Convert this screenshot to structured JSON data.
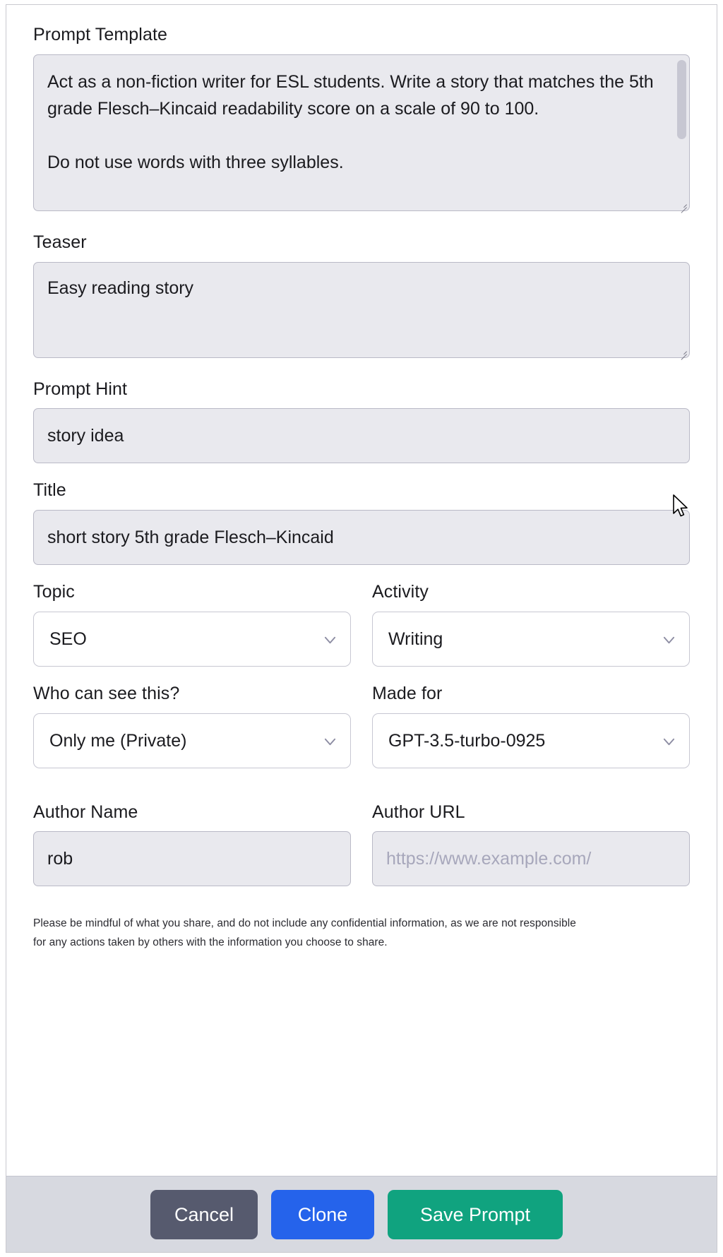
{
  "form": {
    "prompt_template": {
      "label": "Prompt Template",
      "value": "Act as a non-fiction writer for ESL students. Write a story that matches the 5th grade Flesch–Kincaid readability score on a scale of 90 to 100.\n\nDo not use words with three syllables."
    },
    "teaser": {
      "label": "Teaser",
      "value": "Easy reading story"
    },
    "prompt_hint": {
      "label": "Prompt Hint",
      "value": "story idea"
    },
    "title": {
      "label": "Title",
      "value": "short story 5th grade Flesch–Kincaid"
    },
    "topic": {
      "label": "Topic",
      "value": "SEO"
    },
    "activity": {
      "label": "Activity",
      "value": "Writing"
    },
    "visibility": {
      "label": "Who can see this?",
      "value": "Only me (Private)"
    },
    "made_for": {
      "label": "Made for",
      "value": "GPT-3.5-turbo-0925"
    },
    "author_name": {
      "label": "Author Name",
      "value": "rob"
    },
    "author_url": {
      "label": "Author URL",
      "value": "",
      "placeholder": "https://www.example.com/"
    },
    "disclaimer": "Please be mindful of what you share, and do not include any confidential information, as we are not responsible for any actions taken by others with the information you choose to share."
  },
  "footer": {
    "cancel_label": "Cancel",
    "clone_label": "Clone",
    "save_label": "Save Prompt"
  },
  "colors": {
    "cancel": "#565a6e",
    "clone": "#2563eb",
    "save": "#10a37f",
    "footer_bg": "#d7d9e0",
    "field_bg": "#e9e9ee"
  }
}
